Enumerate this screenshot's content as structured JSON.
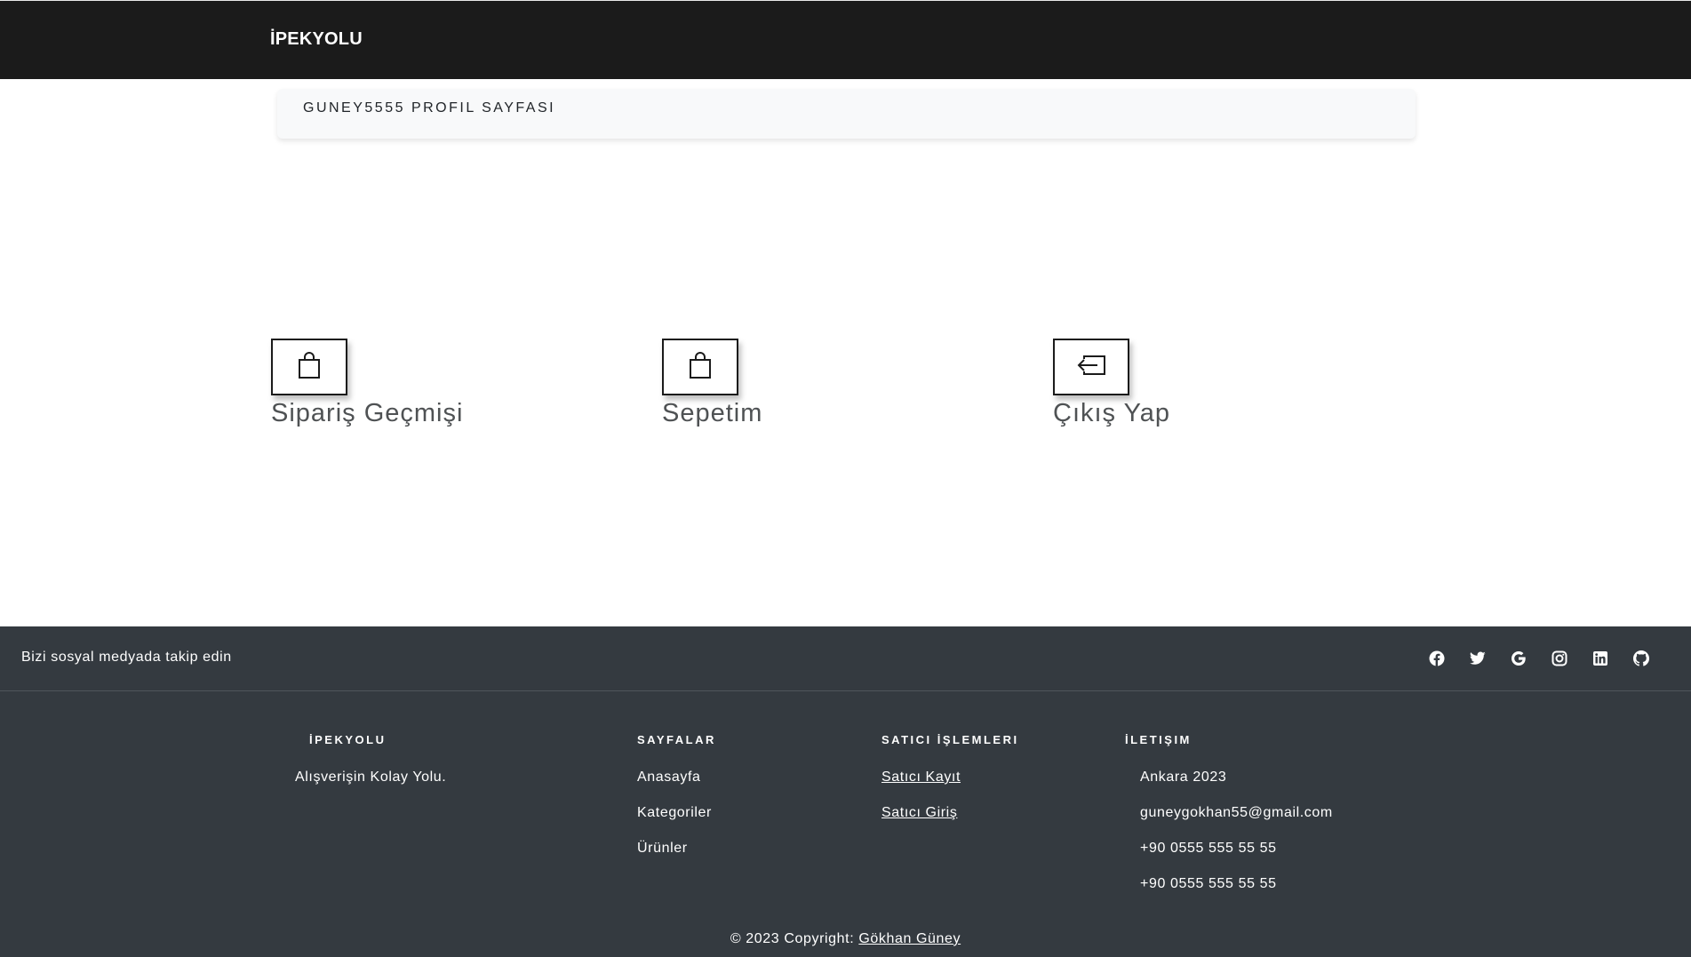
{
  "navbar": {
    "brand": "İPEKYOLU"
  },
  "profile": {
    "title": "GUNEY5555 PROFIL SAYFASI"
  },
  "tiles": [
    {
      "label": "Sipariş Geçmişi",
      "icon": "shopping-bag-icon"
    },
    {
      "label": "Sepetim",
      "icon": "shopping-bag-icon"
    },
    {
      "label": "Çıkış Yap",
      "icon": "logout-icon"
    }
  ],
  "social": {
    "text": "Bizi sosyal medyada takip edin",
    "icons": [
      "facebook-icon",
      "twitter-icon",
      "google-icon",
      "instagram-icon",
      "linkedin-icon",
      "github-icon"
    ]
  },
  "footer": {
    "col1": {
      "heading": "İPEKYOLU",
      "text": "Alışverişin Kolay Yolu."
    },
    "col2": {
      "heading": "SAYFALAR",
      "links": [
        "Anasayfa",
        "Kategoriler",
        "Ürünler"
      ]
    },
    "col3": {
      "heading": "SATICI İŞLEMLERI",
      "links": [
        "Satıcı Kayıt",
        "Satıcı Giriş"
      ]
    },
    "col4": {
      "heading": "İLETIŞIM",
      "items": [
        "Ankara 2023",
        "guneygokhan55@gmail.com",
        "+90 0555 555 55 55",
        "+90 0555 555 55 55"
      ]
    },
    "copyright_prefix": "© 2023 Copyright:",
    "copyright_author": "Gökhan Güney"
  },
  "colors": {
    "navbar_bg": "#1b1b1b",
    "footer_bg": "#343a40",
    "card_bg": "#f8f9fa",
    "tile_label": "#4f5254"
  }
}
